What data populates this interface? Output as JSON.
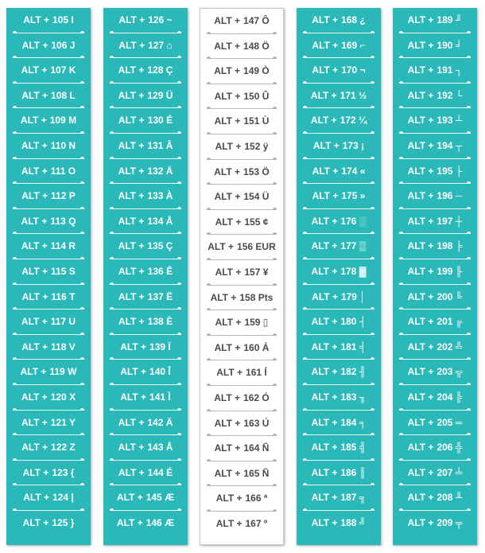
{
  "prefix": "ALT +",
  "columns": [
    {
      "style": "teal",
      "items": [
        {
          "code": "105",
          "ch": "I"
        },
        {
          "code": "106",
          "ch": "J"
        },
        {
          "code": "107",
          "ch": "K"
        },
        {
          "code": "108",
          "ch": "L"
        },
        {
          "code": "109",
          "ch": "M"
        },
        {
          "code": "110",
          "ch": "N"
        },
        {
          "code": "111",
          "ch": "O"
        },
        {
          "code": "112",
          "ch": "P"
        },
        {
          "code": "113",
          "ch": "Q"
        },
        {
          "code": "114",
          "ch": "R"
        },
        {
          "code": "115",
          "ch": "S"
        },
        {
          "code": "116",
          "ch": "T"
        },
        {
          "code": "117",
          "ch": "U"
        },
        {
          "code": "118",
          "ch": "V"
        },
        {
          "code": "119",
          "ch": "W"
        },
        {
          "code": "120",
          "ch": "X"
        },
        {
          "code": "121",
          "ch": "Y"
        },
        {
          "code": "122",
          "ch": "Z"
        },
        {
          "code": "123",
          "ch": "{"
        },
        {
          "code": "124",
          "ch": "|"
        },
        {
          "code": "125",
          "ch": "}"
        }
      ]
    },
    {
      "style": "teal",
      "items": [
        {
          "code": "126",
          "ch": "~"
        },
        {
          "code": "127",
          "ch": "⌂"
        },
        {
          "code": "128",
          "ch": "Ç"
        },
        {
          "code": "129",
          "ch": "Ü"
        },
        {
          "code": "130",
          "ch": "É"
        },
        {
          "code": "131",
          "ch": "Â"
        },
        {
          "code": "132",
          "ch": "Ä"
        },
        {
          "code": "133",
          "ch": "À"
        },
        {
          "code": "134",
          "ch": "Å"
        },
        {
          "code": "135",
          "ch": "Ç"
        },
        {
          "code": "136",
          "ch": "Ê"
        },
        {
          "code": "137",
          "ch": "Ë"
        },
        {
          "code": "138",
          "ch": "È"
        },
        {
          "code": "139",
          "ch": "Ï"
        },
        {
          "code": "140",
          "ch": "Î"
        },
        {
          "code": "141",
          "ch": "Ì"
        },
        {
          "code": "142",
          "ch": "Ä"
        },
        {
          "code": "143",
          "ch": "Å"
        },
        {
          "code": "144",
          "ch": "É"
        },
        {
          "code": "145",
          "ch": "Æ"
        },
        {
          "code": "146",
          "ch": "Æ"
        }
      ]
    },
    {
      "style": "white",
      "items": [
        {
          "code": "147",
          "ch": "Ô"
        },
        {
          "code": "148",
          "ch": "Ö"
        },
        {
          "code": "149",
          "ch": "Ò"
        },
        {
          "code": "150",
          "ch": "Û"
        },
        {
          "code": "151",
          "ch": "Ù"
        },
        {
          "code": "152",
          "ch": "ÿ"
        },
        {
          "code": "153",
          "ch": "Ö"
        },
        {
          "code": "154",
          "ch": "Ü"
        },
        {
          "code": "155",
          "ch": "¢"
        },
        {
          "code": "156",
          "ch": "EUR"
        },
        {
          "code": "157",
          "ch": "¥"
        },
        {
          "code": "158",
          "ch": "Pts"
        },
        {
          "code": "159",
          "ch": "▯"
        },
        {
          "code": "160",
          "ch": "Á"
        },
        {
          "code": "161",
          "ch": "Í"
        },
        {
          "code": "162",
          "ch": "Ó"
        },
        {
          "code": "163",
          "ch": "Ú"
        },
        {
          "code": "164",
          "ch": "Ñ"
        },
        {
          "code": "165",
          "ch": "Ñ"
        },
        {
          "code": "166",
          "ch": "ª"
        },
        {
          "code": "167",
          "ch": "º"
        }
      ]
    },
    {
      "style": "teal",
      "items": [
        {
          "code": "168",
          "ch": "¿"
        },
        {
          "code": "169",
          "ch": "⌐"
        },
        {
          "code": "170",
          "ch": "¬"
        },
        {
          "code": "171",
          "ch": "½"
        },
        {
          "code": "172",
          "ch": "¼"
        },
        {
          "code": "173",
          "ch": "¡"
        },
        {
          "code": "174",
          "ch": "«"
        },
        {
          "code": "175",
          "ch": "»"
        },
        {
          "code": "176",
          "ch": "░"
        },
        {
          "code": "177",
          "ch": "▒"
        },
        {
          "code": "178",
          "ch": "▓"
        },
        {
          "code": "179",
          "ch": "│"
        },
        {
          "code": "180",
          "ch": "┤"
        },
        {
          "code": "181",
          "ch": "╡"
        },
        {
          "code": "182",
          "ch": "╢"
        },
        {
          "code": "183",
          "ch": "╖"
        },
        {
          "code": "184",
          "ch": "╕"
        },
        {
          "code": "185",
          "ch": "╣"
        },
        {
          "code": "186",
          "ch": "║"
        },
        {
          "code": "187",
          "ch": "╗"
        },
        {
          "code": "188",
          "ch": "╝"
        }
      ]
    },
    {
      "style": "teal",
      "items": [
        {
          "code": "189",
          "ch": "╜"
        },
        {
          "code": "190",
          "ch": "╛"
        },
        {
          "code": "191",
          "ch": "┐"
        },
        {
          "code": "192",
          "ch": "└"
        },
        {
          "code": "193",
          "ch": "┴"
        },
        {
          "code": "194",
          "ch": "┬"
        },
        {
          "code": "195",
          "ch": "├"
        },
        {
          "code": "196",
          "ch": "─"
        },
        {
          "code": "197",
          "ch": "┼"
        },
        {
          "code": "198",
          "ch": "╞"
        },
        {
          "code": "199",
          "ch": "╟"
        },
        {
          "code": "200",
          "ch": "╚"
        },
        {
          "code": "201",
          "ch": "╔"
        },
        {
          "code": "202",
          "ch": "╩"
        },
        {
          "code": "203",
          "ch": "╦"
        },
        {
          "code": "204",
          "ch": "╠"
        },
        {
          "code": "205",
          "ch": "═"
        },
        {
          "code": "206",
          "ch": "╬"
        },
        {
          "code": "207",
          "ch": "╧"
        },
        {
          "code": "208",
          "ch": "╨"
        },
        {
          "code": "209",
          "ch": "╤"
        }
      ]
    }
  ]
}
